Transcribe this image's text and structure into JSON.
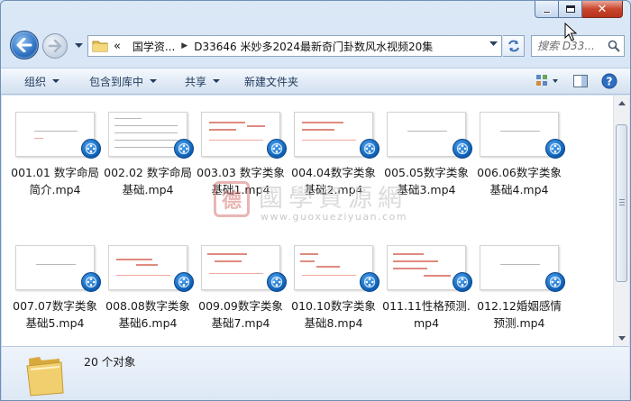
{
  "address": {
    "crumbs": [
      "国学资...",
      "D33646 米妙多2024最新奇门卦数风水视频20集"
    ],
    "overflow_glyph": "«"
  },
  "search": {
    "placeholder": "搜索 D33..."
  },
  "toolbar": {
    "organize": "组织",
    "include_in_library": "包含到库中",
    "share": "共享",
    "new_folder": "新建文件夹"
  },
  "files": [
    {
      "line1": "001.01 数字命局",
      "line2": "简介.mp4"
    },
    {
      "line1": "002.02 数字命局",
      "line2": "基础.mp4"
    },
    {
      "line1": "003.03 数字类象",
      "line2": "基础1.mp4"
    },
    {
      "line1": "004.04数字类象",
      "line2": "基础2.mp4"
    },
    {
      "line1": "005.05数字类象",
      "line2": "基础3.mp4"
    },
    {
      "line1": "006.06数字类象",
      "line2": "基础4.mp4"
    },
    {
      "line1": "007.07数字类象",
      "line2": "基础5.mp4"
    },
    {
      "line1": "008.08数字类象",
      "line2": "基础6.mp4"
    },
    {
      "line1": "009.09数字类象",
      "line2": "基础7.mp4"
    },
    {
      "line1": "010.10数字类象",
      "line2": "基础8.mp4"
    },
    {
      "line1": "011.11性格预测.",
      "line2": "mp4"
    },
    {
      "line1": "012.12婚姻感情",
      "line2": "预测.mp4"
    }
  ],
  "watermark": {
    "seal": "德",
    "name": "國學資源網",
    "url": "www.guoxueziyuan.com"
  },
  "status": {
    "count_text": "20 个对象"
  },
  "icons": {
    "back": "back-arrow-icon",
    "forward": "forward-arrow-icon",
    "refresh": "refresh-icon",
    "search": "search-icon",
    "video_badge": "video-play-icon",
    "folder": "folder-icon",
    "help": "help-icon"
  },
  "colors": {
    "accent": "#2b6fbf",
    "close": "#c9452d",
    "link": "#1e395b"
  }
}
